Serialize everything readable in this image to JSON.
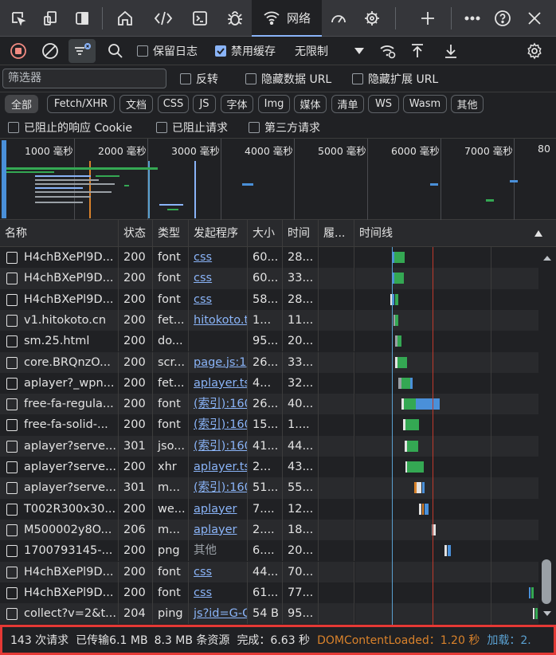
{
  "tabs": {
    "network_label": "网络"
  },
  "toolbar": {
    "preserve_log": "保留日志",
    "disable_cache": "禁用缓存",
    "throttle": "无限制"
  },
  "filter": {
    "placeholder": "筛选器",
    "invert": "反转",
    "hide_data_url": "隐藏数据 URL",
    "hide_ext_url": "隐藏扩展 URL"
  },
  "types": [
    "全部",
    "Fetch/XHR",
    "文档",
    "CSS",
    "JS",
    "字体",
    "Img",
    "媒体",
    "清单",
    "WS",
    "Wasm",
    "其他"
  ],
  "blocked": {
    "blocked_cookie": "已阻止的响应 Cookie",
    "blocked_req": "已阻止请求",
    "third_party": "第三方请求"
  },
  "overview_ticks": [
    "1000 毫秒",
    "2000 毫秒",
    "3000 毫秒",
    "4000 毫秒",
    "5000 毫秒",
    "6000 毫秒",
    "7000 毫秒",
    "80"
  ],
  "columns": {
    "name": "名称",
    "status": "状态",
    "type": "类型",
    "initiator": "发起程序",
    "size": "大小",
    "time": "时间",
    "fulfilled": "履...",
    "waterfall": "时间线"
  },
  "rows": [
    {
      "icon": "font",
      "name": "H4chBXePl9D...",
      "status": "200",
      "type": "font",
      "initiator": "css",
      "link": true,
      "size": "60...",
      "time": "28..."
    },
    {
      "icon": "font",
      "name": "H4chBXePl9D...",
      "status": "200",
      "type": "font",
      "initiator": "css",
      "link": true,
      "size": "60...",
      "time": "33..."
    },
    {
      "icon": "font",
      "name": "H4chBXePl9D...",
      "status": "200",
      "type": "font",
      "initiator": "css",
      "link": true,
      "size": "58...",
      "time": "28..."
    },
    {
      "icon": "fetch",
      "name": "v1.hitokoto.cn",
      "status": "200",
      "type": "fet...",
      "initiator": "hitokoto.t",
      "link": true,
      "size": "1...",
      "time": "11..."
    },
    {
      "icon": "doc",
      "name": "sm.25.html",
      "status": "200",
      "type": "do...",
      "initiator": "",
      "link": false,
      "size": "95...",
      "time": "20..."
    },
    {
      "icon": "script",
      "name": "core.BRQnzO...",
      "status": "200",
      "type": "scr...",
      "initiator": "page.js:1",
      "link": true,
      "size": "26...",
      "time": "33..."
    },
    {
      "icon": "fetch",
      "name": "aplayer?_wpn...",
      "status": "200",
      "type": "fet...",
      "initiator": "aplayer.ts",
      "link": true,
      "size": "4...",
      "time": "32..."
    },
    {
      "icon": "font",
      "name": "free-fa-regula...",
      "status": "200",
      "type": "font",
      "initiator": "(索引):160",
      "link": true,
      "size": "26...",
      "time": "40..."
    },
    {
      "icon": "font",
      "name": "free-fa-solid-...",
      "status": "200",
      "type": "font",
      "initiator": "(索引):160",
      "link": true,
      "size": "15...",
      "time": "1...."
    },
    {
      "icon": "json",
      "name": "aplayer?serve...",
      "status": "301",
      "type": "jso...",
      "initiator": "(索引):160",
      "link": true,
      "size": "41...",
      "time": "44..."
    },
    {
      "icon": "xhr",
      "name": "aplayer?serve...",
      "status": "200",
      "type": "xhr",
      "initiator": "aplayer.ts",
      "link": true,
      "size": "2...",
      "time": "43..."
    },
    {
      "icon": "json",
      "name": "aplayer?serve...",
      "status": "301",
      "type": "m...",
      "initiator": "(索引):160",
      "link": true,
      "size": "51...",
      "time": "55..."
    },
    {
      "icon": "img",
      "name": "T002R300x30...",
      "status": "200",
      "type": "we...",
      "initiator": "aplayer",
      "link": true,
      "size": "7....",
      "time": "12..."
    },
    {
      "icon": "media",
      "name": "M500002y8O...",
      "status": "206",
      "type": "m...",
      "initiator": "aplayer",
      "link": true,
      "size": "2....",
      "time": "18..."
    },
    {
      "icon": "png",
      "name": "1700793145-...",
      "status": "200",
      "type": "png",
      "initiator": "其他",
      "link": false,
      "size": "6....",
      "time": "20..."
    },
    {
      "icon": "font",
      "name": "H4chBXePl9D...",
      "status": "200",
      "type": "font",
      "initiator": "css",
      "link": true,
      "size": "44...",
      "time": "70..."
    },
    {
      "icon": "font",
      "name": "H4chBXePl9D...",
      "status": "200",
      "type": "font",
      "initiator": "css",
      "link": true,
      "size": "61...",
      "time": "77..."
    },
    {
      "icon": "other",
      "name": "collect?v=2&t...",
      "status": "204",
      "type": "ping",
      "initiator": "js?id=G-C",
      "link": true,
      "size": "54 B",
      "time": "95..."
    }
  ],
  "status": {
    "requests": "143 次请求",
    "transferred": "已传输6.1 MB",
    "resources": "8.3 MB 条资源",
    "finish": "完成：6.63 秒",
    "dcl": "DOMContentLoaded：1.20 秒",
    "load": "加载：2."
  },
  "colors": {
    "dcl": "#d9822b",
    "load": "#4a90d9",
    "accent": "#8ab4f8",
    "highlight": "#e53935"
  }
}
